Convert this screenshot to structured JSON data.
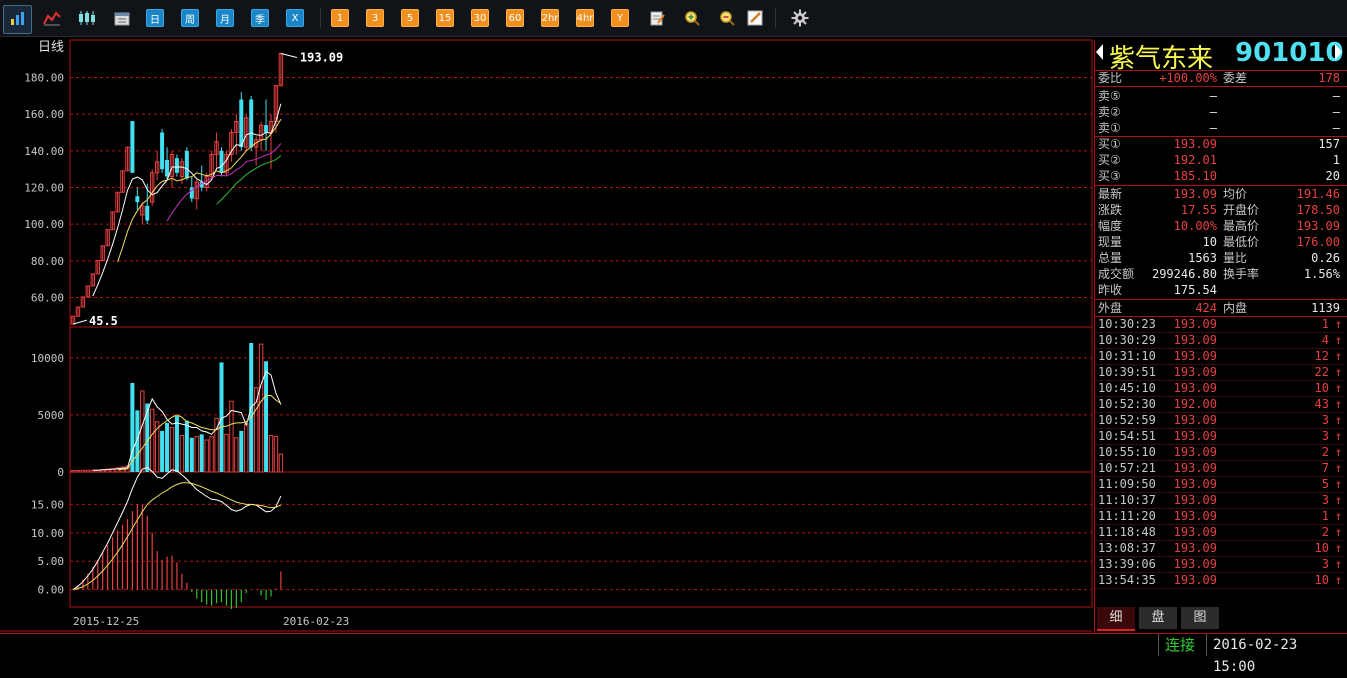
{
  "toolbar": {
    "items": [
      {
        "name": "bar-chart-icon",
        "label": "",
        "style": "icon"
      },
      {
        "name": "line-chart-icon",
        "label": "",
        "style": "icon"
      },
      {
        "name": "candlestick-icon",
        "label": "",
        "style": "icon"
      },
      {
        "name": "calendar-icon",
        "label": "",
        "style": "icon"
      },
      {
        "name": "period-day-button",
        "label": "日",
        "style": "blue"
      },
      {
        "name": "period-week-button",
        "label": "周",
        "style": "blue"
      },
      {
        "name": "period-month-button",
        "label": "月",
        "style": "blue"
      },
      {
        "name": "period-quarter-button",
        "label": "季",
        "style": "blue"
      },
      {
        "name": "period-x-button",
        "label": "X",
        "style": "blue"
      },
      {
        "name": "period-1-button",
        "label": "1",
        "style": "orange"
      },
      {
        "name": "period-3-button",
        "label": "3",
        "style": "orange"
      },
      {
        "name": "period-5-button",
        "label": "5",
        "style": "orange"
      },
      {
        "name": "period-15-button",
        "label": "15",
        "style": "orange"
      },
      {
        "name": "period-30-button",
        "label": "30",
        "style": "orange"
      },
      {
        "name": "period-60-button",
        "label": "60",
        "style": "orange"
      },
      {
        "name": "period-2hr-button",
        "label": "2hr",
        "style": "orange"
      },
      {
        "name": "period-4hr-button",
        "label": "4hr",
        "style": "orange"
      },
      {
        "name": "period-year-button",
        "label": "Y",
        "style": "orange"
      },
      {
        "name": "edit-note-icon",
        "label": "",
        "style": "icon"
      },
      {
        "name": "zoom-in-icon",
        "label": "",
        "style": "icon"
      },
      {
        "name": "zoom-out-icon",
        "label": "",
        "style": "icon"
      },
      {
        "name": "draw-pen-icon",
        "label": "",
        "style": "icon"
      },
      {
        "name": "gear-icon",
        "label": "",
        "style": "icon"
      }
    ]
  },
  "chart_data": {
    "type": "candlestick",
    "period_label": "日线",
    "price_ticks": [
      "180.00",
      "160.00",
      "140.00",
      "120.00",
      "100.00",
      "80.00",
      "60.00"
    ],
    "volume_ticks": [
      "10000",
      "5000",
      "0"
    ],
    "macd_ticks": [
      "15.00",
      "10.00",
      "5.00",
      "0.00"
    ],
    "x_labels": [
      "2015-12-25",
      "2016-02-23"
    ],
    "high_label": "193.09",
    "low_label": "45.5",
    "price_ylim": [
      45,
      195
    ],
    "volume_ylim": [
      0,
      12000
    ],
    "macd_ylim": [
      -2,
      20
    ],
    "candles": [
      [
        45.5,
        49.8,
        45.5,
        49.8
      ],
      [
        49.8,
        54.8,
        49.8,
        54.8
      ],
      [
        54.8,
        60.3,
        54.8,
        60.3
      ],
      [
        60.3,
        66.3,
        60.3,
        66.3
      ],
      [
        66.3,
        72.9,
        66.3,
        72.9
      ],
      [
        72.9,
        80.2,
        72.9,
        80.2
      ],
      [
        80.2,
        88.2,
        80.2,
        88.2
      ],
      [
        88.2,
        97.0,
        88.2,
        97.0
      ],
      [
        97.0,
        106.7,
        97.0,
        106.7
      ],
      [
        106.7,
        117.4,
        106.7,
        117.4
      ],
      [
        117.4,
        129.1,
        117.4,
        129.1
      ],
      [
        129.1,
        142.0,
        129.1,
        142.0
      ],
      [
        156.2,
        156.2,
        128.0,
        128.0
      ],
      [
        115.2,
        120.0,
        108.0,
        112.0
      ],
      [
        105.0,
        112.0,
        100.0,
        110.0
      ],
      [
        110.0,
        122.0,
        100.0,
        102.0
      ],
      [
        112.0,
        130.0,
        110.0,
        128.0
      ],
      [
        128.0,
        140.0,
        124.0,
        134.0
      ],
      [
        150.0,
        152.0,
        128.0,
        130.0
      ],
      [
        135.0,
        142.0,
        124.0,
        126.0
      ],
      [
        126.0,
        140.0,
        120.0,
        138.0
      ],
      [
        136.0,
        138.0,
        126.0,
        128.0
      ],
      [
        126.0,
        136.0,
        122.0,
        134.0
      ],
      [
        140.0,
        142.0,
        124.0,
        125.0
      ],
      [
        120.0,
        126.0,
        112.0,
        114.0
      ],
      [
        114.0,
        125.0,
        108.0,
        123.0
      ],
      [
        123.0,
        132.0,
        118.0,
        120.0
      ],
      [
        120.0,
        128.0,
        118.0,
        126.0
      ],
      [
        126.0,
        140.0,
        124.0,
        138.0
      ],
      [
        138.0,
        150.0,
        130.0,
        145.0
      ],
      [
        140.0,
        142.0,
        126.0,
        128.0
      ],
      [
        128.0,
        140.0,
        126.0,
        138.0
      ],
      [
        138.0,
        152.0,
        134.0,
        150.0
      ],
      [
        150.0,
        160.0,
        138.0,
        156.0
      ],
      [
        168.0,
        172.0,
        140.0,
        142.0
      ],
      [
        142.0,
        160.0,
        140.0,
        158.0
      ],
      [
        168.0,
        170.0,
        140.0,
        142.0
      ],
      [
        142.0,
        148.0,
        132.0,
        146.0
      ],
      [
        146.0,
        156.0,
        140.0,
        154.0
      ],
      [
        154.0,
        168.0,
        140.0,
        150.0
      ],
      [
        150.0,
        160.0,
        130.0,
        156.0
      ],
      [
        156.0,
        176.0,
        150.0,
        175.5
      ],
      [
        175.5,
        193.1,
        175.5,
        193.1
      ]
    ],
    "volume": [
      120,
      130,
      140,
      150,
      160,
      180,
      220,
      260,
      300,
      360,
      440,
      520,
      7800,
      5400,
      7100,
      6000,
      5500,
      4400,
      3600,
      4300,
      3900,
      4900,
      3200,
      4500,
      3000,
      3100,
      3300,
      2800,
      3100,
      4700,
      9600,
      3300,
      6200,
      3000,
      3600,
      4200,
      11300,
      7400,
      11200,
      9700,
      3200,
      3100,
      1563
    ],
    "volume_ma5": [
      null,
      null,
      null,
      null,
      150,
      160,
      180,
      210,
      240,
      280,
      320,
      380,
      1850,
      2900,
      4100,
      5300,
      6400,
      5700,
      5300,
      4600,
      4200,
      4300,
      4200,
      4100,
      3900,
      3900,
      3600,
      3500,
      3300,
      3800,
      4700,
      4900,
      5400,
      5300,
      5200,
      4100,
      5700,
      6100,
      7700,
      8800,
      8500,
      6900,
      5900
    ],
    "volume_ma10": [
      null,
      null,
      null,
      null,
      null,
      null,
      null,
      null,
      null,
      200,
      230,
      270,
      1000,
      1500,
      2100,
      2700,
      3300,
      3800,
      4200,
      4500,
      4800,
      5000,
      4800,
      4400,
      4300,
      4100,
      3900,
      3800,
      3700,
      3700,
      4000,
      4000,
      4200,
      4300,
      4300,
      4400,
      4800,
      5500,
      6200,
      6700,
      6700,
      6300,
      6000
    ],
    "dif": [
      0,
      0.6,
      1.4,
      2.4,
      3.6,
      5,
      6.6,
      8.2,
      10,
      11.8,
      13.6,
      15.5,
      17.8,
      19.8,
      21.2,
      21.5,
      20.8,
      19.8,
      19.6,
      20.4,
      21.1,
      20.9,
      20.2,
      19.4,
      18.5,
      17.6,
      17,
      16.4,
      15.9,
      15.8,
      15.5,
      14.8,
      14.1,
      13.8,
      14.1,
      14.7,
      15,
      14.9,
      14.3,
      13.7,
      13.8,
      14.6,
      16.5
    ],
    "dea": [
      0,
      0.2,
      0.5,
      1,
      1.6,
      2.4,
      3.3,
      4.3,
      5.4,
      6.6,
      7.9,
      9.3,
      10.8,
      12.3,
      13.7,
      15,
      15.8,
      16.4,
      17,
      17.5,
      18.1,
      18.5,
      18.8,
      18.8,
      18.7,
      18.4,
      18.1,
      17.7,
      17.3,
      17,
      16.6,
      16.2,
      15.8,
      15.4,
      15.2,
      15,
      15,
      14.9,
      14.8,
      14.6,
      14.4,
      14.5,
      14.9
    ],
    "macd_bar": [
      0,
      0.8,
      1.8,
      2.8,
      4,
      5.2,
      6.6,
      7.8,
      9.2,
      10.4,
      11.4,
      12.4,
      13.8,
      15,
      15,
      13,
      10,
      6.8,
      5.2,
      5.8,
      6,
      4.8,
      2.8,
      1.2,
      -0.4,
      -1.6,
      -2.2,
      -2.6,
      -2.8,
      -2.4,
      -2.2,
      -2.8,
      -3.4,
      -3.2,
      -2.2,
      -0.6,
      0,
      0,
      -1,
      -1.8,
      -1.2,
      0.2,
      3.2
    ]
  },
  "quote": {
    "name": "紫气东来",
    "code": "901010",
    "rows1": [
      {
        "l": "委比",
        "v1": "+100.00%",
        "c1": "red",
        "l2": "委差",
        "v2": "178",
        "c2": "red"
      }
    ],
    "sell": [
      {
        "l": "卖⑤",
        "v1": "—",
        "v2": "—"
      },
      {
        "l": "卖②",
        "v1": "—",
        "v2": "—"
      },
      {
        "l": "卖①",
        "v1": "—",
        "v2": "—"
      }
    ],
    "buy": [
      {
        "l": "买①",
        "v1": "193.09",
        "v2": "157"
      },
      {
        "l": "买②",
        "v1": "192.01",
        "v2": "1"
      },
      {
        "l": "买③",
        "v1": "185.10",
        "v2": "20"
      }
    ],
    "stats": [
      {
        "l": "最新",
        "v1": "193.09",
        "c1": "red",
        "l2": "均价",
        "v2": "191.46",
        "c2": "red"
      },
      {
        "l": "涨跌",
        "v1": "17.55",
        "c1": "red",
        "l2": "开盘价",
        "v2": "178.50",
        "c2": "red"
      },
      {
        "l": "幅度",
        "v1": "10.00%",
        "c1": "red",
        "l2": "最高价",
        "v2": "193.09",
        "c2": "red"
      },
      {
        "l": "现量",
        "v1": "10",
        "c1": "wht",
        "l2": "最低价",
        "v2": "176.00",
        "c2": "red"
      },
      {
        "l": "总量",
        "v1": "1563",
        "c1": "wht",
        "l2": "量比",
        "v2": "0.26",
        "c2": "wht"
      },
      {
        "l": "成交额",
        "v1": "299246.80",
        "c1": "wht",
        "l2": "换手率",
        "v2": "1.56%",
        "c2": "wht"
      },
      {
        "l": "昨收",
        "v1": "175.54",
        "c1": "wht",
        "l2": "",
        "v2": "",
        "c2": "wht"
      }
    ],
    "outer": {
      "l": "外盘",
      "v1": "424",
      "l2": "内盘",
      "v2": "1139"
    },
    "ticks": [
      {
        "t": "10:30:23",
        "p": "193.09",
        "v": "1"
      },
      {
        "t": "10:30:29",
        "p": "193.09",
        "v": "4"
      },
      {
        "t": "10:31:10",
        "p": "193.09",
        "v": "12"
      },
      {
        "t": "10:39:51",
        "p": "193.09",
        "v": "22"
      },
      {
        "t": "10:45:10",
        "p": "193.09",
        "v": "10"
      },
      {
        "t": "10:52:30",
        "p": "192.00",
        "v": "43"
      },
      {
        "t": "10:52:59",
        "p": "193.09",
        "v": "3"
      },
      {
        "t": "10:54:51",
        "p": "193.09",
        "v": "3"
      },
      {
        "t": "10:55:10",
        "p": "193.09",
        "v": "2"
      },
      {
        "t": "10:57:21",
        "p": "193.09",
        "v": "7"
      },
      {
        "t": "11:09:50",
        "p": "193.09",
        "v": "5"
      },
      {
        "t": "11:10:37",
        "p": "193.09",
        "v": "3"
      },
      {
        "t": "11:11:20",
        "p": "193.09",
        "v": "1"
      },
      {
        "t": "11:18:48",
        "p": "193.09",
        "v": "2"
      },
      {
        "t": "13:08:37",
        "p": "193.09",
        "v": "10"
      },
      {
        "t": "13:39:06",
        "p": "193.09",
        "v": "3"
      },
      {
        "t": "13:54:35",
        "p": "193.09",
        "v": "10"
      }
    ],
    "tick_arrow": "↑",
    "tabs": [
      "细",
      "盘",
      "图"
    ]
  },
  "status": {
    "connection": "连接",
    "datetime": "2016-02-23 15:00"
  },
  "colors": {
    "up": "#e84040",
    "down": "#40e0f0",
    "grid": "#b01010",
    "ma1": "#ffffff",
    "ma2": "#f0e060",
    "ma3": "#c030c0",
    "ma4": "#30c030"
  }
}
